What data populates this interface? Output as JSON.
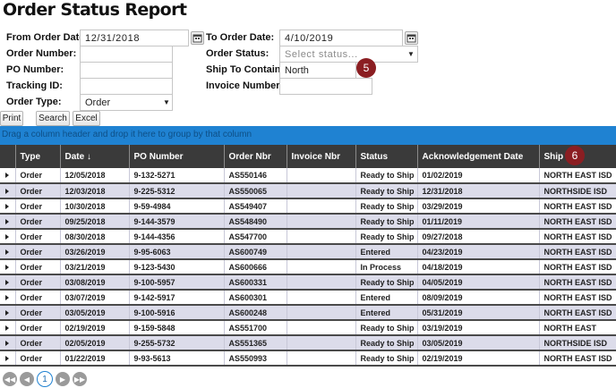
{
  "page": {
    "title": "Order Status Report"
  },
  "filters": {
    "from_order_date": {
      "label": "From Order Date:",
      "value": "12/31/2018"
    },
    "to_order_date": {
      "label": "To Order Date:",
      "value": "4/10/2019"
    },
    "order_number": {
      "label": "Order Number:",
      "value": ""
    },
    "order_status": {
      "label": "Order Status:",
      "placeholder": "Select status..."
    },
    "po_number": {
      "label": "PO Number:",
      "value": ""
    },
    "ship_to_contains": {
      "label": "Ship To Contains:",
      "value": "North"
    },
    "tracking_id": {
      "label": "Tracking ID:",
      "value": ""
    },
    "invoice_number": {
      "label": "Invoice Number:",
      "value": ""
    },
    "order_type": {
      "label": "Order Type:",
      "value": "Order"
    }
  },
  "buttons": {
    "print": "Print",
    "search": "Search",
    "excel": "Excel"
  },
  "callouts": {
    "five": "5",
    "six": "6"
  },
  "grid": {
    "group_hint": "Drag a column header and drop it here to group by that column",
    "columns": [
      "",
      "Type",
      "Date ↓",
      "PO Number",
      "Order Nbr",
      "Invoice Nbr",
      "Status",
      "Acknowledgement Date",
      "Ship T"
    ],
    "rows": [
      [
        "Order",
        "12/05/2018",
        "9-132-5271",
        "AS550146",
        "",
        "Ready to Ship",
        "01/02/2019",
        "NORTH EAST ISD"
      ],
      [
        "Order",
        "12/03/2018",
        "9-225-5312",
        "AS550065",
        "",
        "Ready to Ship",
        "12/31/2018",
        "NORTHSIDE ISD"
      ],
      [
        "Order",
        "10/30/2018",
        "9-59-4984",
        "AS549407",
        "",
        "Ready to Ship",
        "03/29/2019",
        "NORTH EAST ISD"
      ],
      [
        "Order",
        "09/25/2018",
        "9-144-3579",
        "AS548490",
        "",
        "Ready to Ship",
        "01/11/2019",
        "NORTH EAST ISD"
      ],
      [
        "Order",
        "08/30/2018",
        "9-144-4356",
        "AS547700",
        "",
        "Ready to Ship",
        "09/27/2018",
        "NORTH EAST ISD"
      ],
      [
        "Order",
        "03/26/2019",
        "9-95-6063",
        "AS600749",
        "",
        "Entered",
        "04/23/2019",
        "NORTH EAST ISD"
      ],
      [
        "Order",
        "03/21/2019",
        "9-123-5430",
        "AS600666",
        "",
        "In Process",
        "04/18/2019",
        "NORTH EAST ISD"
      ],
      [
        "Order",
        "03/08/2019",
        "9-100-5957",
        "AS600331",
        "",
        "Ready to Ship",
        "04/05/2019",
        "NORTH EAST ISD"
      ],
      [
        "Order",
        "03/07/2019",
        "9-142-5917",
        "AS600301",
        "",
        "Entered",
        "08/09/2019",
        "NORTH EAST ISD"
      ],
      [
        "Order",
        "03/05/2019",
        "9-100-5916",
        "AS600248",
        "",
        "Entered",
        "05/31/2019",
        "NORTH EAST ISD"
      ],
      [
        "Order",
        "02/19/2019",
        "9-159-5848",
        "AS551700",
        "",
        "Ready to Ship",
        "03/19/2019",
        "NORTH EAST"
      ],
      [
        "Order",
        "02/05/2019",
        "9-255-5732",
        "AS551365",
        "",
        "Ready to Ship",
        "03/05/2019",
        "NORTHSIDE ISD"
      ],
      [
        "Order",
        "01/22/2019",
        "9-93-5613",
        "AS550993",
        "",
        "Ready to Ship",
        "02/19/2019",
        "NORTH EAST ISD"
      ]
    ]
  },
  "pager": {
    "current_page": "1"
  },
  "colors": {
    "header_bg": "#3a3a3a",
    "group_bar": "#1f82d2",
    "alt_row": "#dcdcea",
    "badge": "#8b1e22"
  }
}
